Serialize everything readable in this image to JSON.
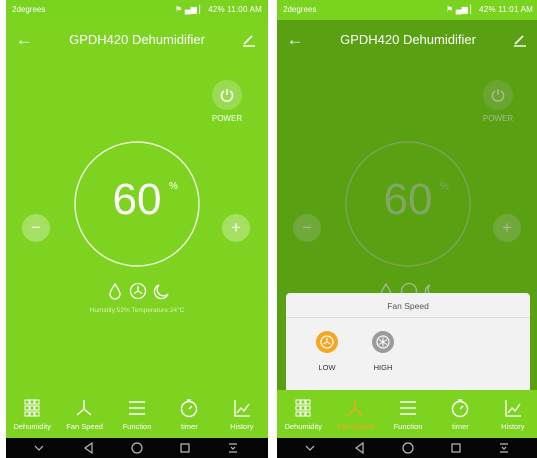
{
  "screens": [
    {
      "status": {
        "carrier": "2degrees",
        "right": "⚑ ▄▆ ▏ 42% 11:00 AM"
      },
      "header": {
        "title": "GPDH420 Dehumidifier"
      },
      "power_label": "POWER",
      "dial": {
        "value": "60",
        "unit": "%"
      },
      "readout": "Humidity:52%  Temperature:24°C",
      "tabs": [
        {
          "label": "Dehumidity",
          "icon": "grid-icon"
        },
        {
          "label": "Fan Speed",
          "icon": "fan-icon"
        },
        {
          "label": "Function",
          "icon": "menu-icon"
        },
        {
          "label": "timer",
          "icon": "timer-icon"
        },
        {
          "label": "History",
          "icon": "history-chart-icon"
        }
      ],
      "active_tab": null
    },
    {
      "status": {
        "carrier": "2degrees",
        "right": "⚑ ▄▆ ▏ 42% 11:01 AM"
      },
      "header": {
        "title": "GPDH420 Dehumidifier"
      },
      "power_label": "POWER",
      "dial": {
        "value": "60",
        "unit": "%"
      },
      "tabs": [
        {
          "label": "Dehumidity",
          "icon": "grid-icon"
        },
        {
          "label": "Fan Speed",
          "icon": "fan-icon"
        },
        {
          "label": "Function",
          "icon": "menu-icon"
        },
        {
          "label": "timer",
          "icon": "timer-icon"
        },
        {
          "label": "History",
          "icon": "history-chart-icon"
        }
      ],
      "active_tab": "Fan Speed",
      "sheet": {
        "title": "Fan Speed",
        "options": [
          {
            "label": "LOW",
            "selected": true,
            "color": "#f5a623"
          },
          {
            "label": "HIGH",
            "selected": false,
            "color": "#9b9b9b"
          }
        ]
      }
    }
  ],
  "colors": {
    "app_green": "#7ed321",
    "active_orange": "#f5a623",
    "nav_black": "#050505"
  }
}
